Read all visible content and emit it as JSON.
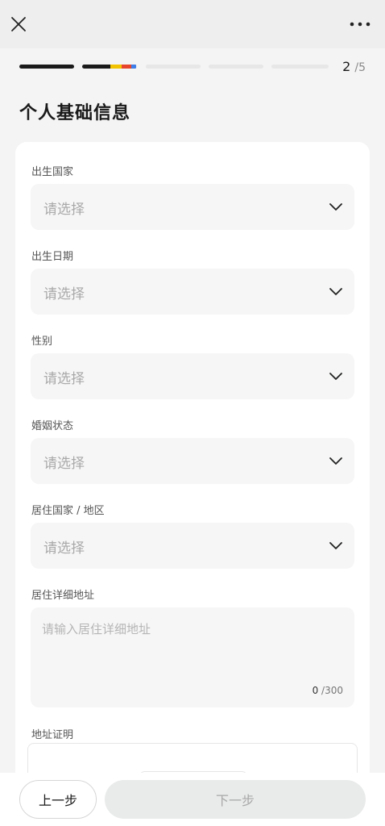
{
  "header": {
    "close_icon": "close-icon",
    "more_icon": "more-icon"
  },
  "progress": {
    "current": "2",
    "total": "/5",
    "steps_total": 5,
    "steps_completed": 1,
    "current_step_fill": 0.98,
    "colors": {
      "done": "#1a1a1a",
      "empty": "#e6e7e6",
      "current_parts": [
        "#1a1a1a",
        "#f2c300",
        "#e8462c",
        "#3f7ee8"
      ]
    }
  },
  "page": {
    "title": "个人基础信息"
  },
  "form": {
    "fields": [
      {
        "label": "出生国家",
        "placeholder": "请选择"
      },
      {
        "label": "出生日期",
        "placeholder": "请选择"
      },
      {
        "label": "性别",
        "placeholder": "请选择"
      },
      {
        "label": "婚姻状态",
        "placeholder": "请选择"
      },
      {
        "label": "居住国家 / 地区",
        "placeholder": "请选择"
      }
    ],
    "address": {
      "label": "居住详细地址",
      "placeholder": "请输入居住详细地址",
      "count": "0",
      "max": "/300"
    },
    "proof": {
      "label": "地址证明"
    }
  },
  "footer": {
    "prev_label": "上一步",
    "next_label": "下一步"
  }
}
